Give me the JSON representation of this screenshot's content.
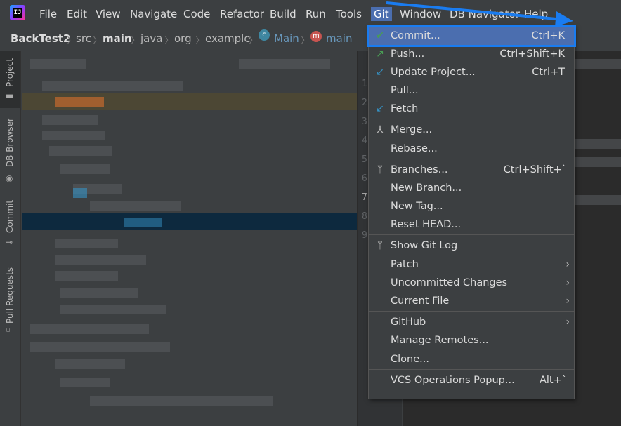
{
  "menubar": {
    "items": [
      "File",
      "Edit",
      "View",
      "Navigate",
      "Code",
      "Refactor",
      "Build",
      "Run",
      "Tools",
      "Git",
      "Window",
      "DB Navigator",
      "Help"
    ]
  },
  "breadcrumb": {
    "project": "BackTest2",
    "parts": [
      "src",
      "main",
      "java",
      "org",
      "example"
    ],
    "class_name": "Main",
    "method_name": "main"
  },
  "toolstrip": {
    "tabs": [
      "Project",
      "DB Browser",
      "Commit",
      "Pull Requests"
    ]
  },
  "gutter": {
    "lines": [
      "1",
      "2",
      "3",
      "4",
      "5",
      "6",
      "7",
      "8",
      "9"
    ],
    "current": "7"
  },
  "git_menu": {
    "commit": {
      "label": "Commit...",
      "shortcut": "Ctrl+K"
    },
    "push": {
      "label": "Push...",
      "shortcut": "Ctrl+Shift+K"
    },
    "update": {
      "label": "Update Project...",
      "shortcut": "Ctrl+T"
    },
    "pull": {
      "label": "Pull..."
    },
    "fetch": {
      "label": "Fetch"
    },
    "merge": {
      "label": "Merge..."
    },
    "rebase": {
      "label": "Rebase..."
    },
    "branches": {
      "label": "Branches...",
      "shortcut": "Ctrl+Shift+`"
    },
    "new_branch": {
      "label": "New Branch..."
    },
    "new_tag": {
      "label": "New Tag..."
    },
    "reset_head": {
      "label": "Reset HEAD..."
    },
    "show_log": {
      "label": "Show Git Log"
    },
    "patch": {
      "label": "Patch"
    },
    "uncommitted": {
      "label": "Uncommitted Changes"
    },
    "current_file": {
      "label": "Current File"
    },
    "github": {
      "label": "GitHub"
    },
    "manage_remotes": {
      "label": "Manage Remotes..."
    },
    "clone": {
      "label": "Clone..."
    },
    "vcs_popup": {
      "label": "VCS Operations Popup...",
      "shortcut": "Alt+`"
    }
  },
  "colors": {
    "accent": "#4b6eaf",
    "highlight_outline": "#1a7cf0",
    "commit_icon": "#499c54",
    "update_icon": "#3592c4"
  }
}
